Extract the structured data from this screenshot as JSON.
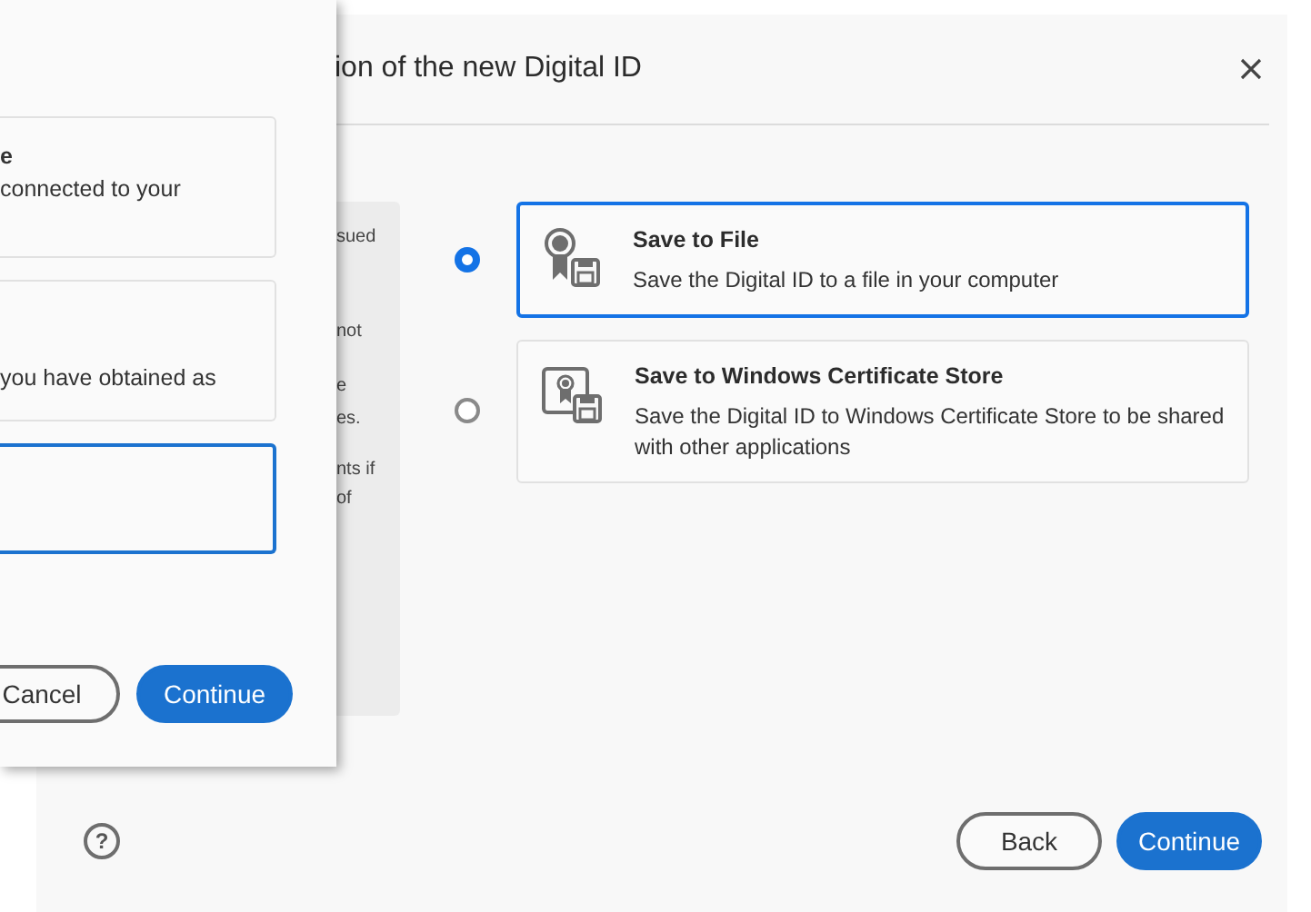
{
  "back_dialog": {
    "title": "ion of the new Digital ID",
    "info_fragments": [
      "sued",
      "not",
      "e",
      "es.",
      "nts if",
      "of"
    ],
    "options": [
      {
        "kind": "file",
        "title": "Save to File",
        "description": "Save the Digital ID to a file in your computer",
        "selected": true
      },
      {
        "kind": "store",
        "title": "Save to Windows Certificate Store",
        "description": "Save the Digital ID to Windows Certificate Store to be shared with other applications",
        "selected": false
      }
    ],
    "help": "?",
    "buttons": [
      {
        "label": "Back",
        "kind": "secondary"
      },
      {
        "label": "Continue",
        "kind": "primary"
      }
    ]
  },
  "front_dialog": {
    "options": [
      {
        "title": "e",
        "description": "connected to your",
        "selected": false
      },
      {
        "description": "you have obtained as",
        "selected": false
      },
      {
        "selected": true
      }
    ],
    "buttons": [
      {
        "label": "Cancel",
        "kind": "secondary"
      },
      {
        "label": "Continue",
        "kind": "primary"
      }
    ]
  }
}
